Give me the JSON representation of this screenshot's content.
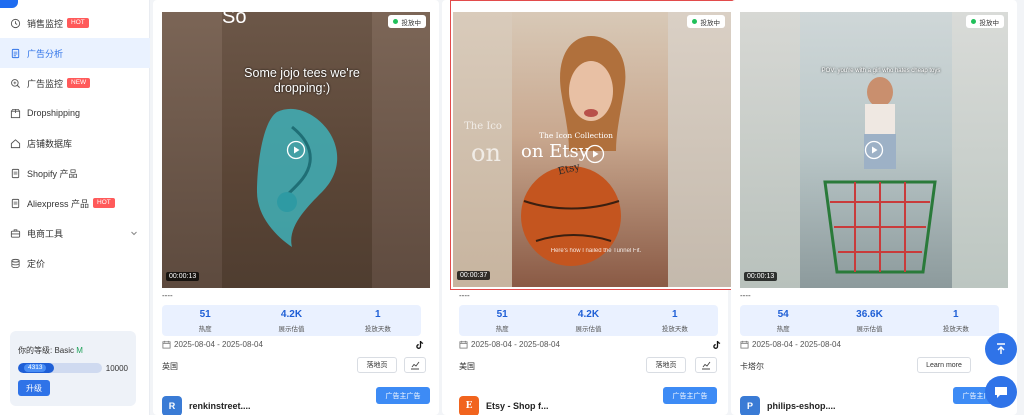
{
  "sidebar": {
    "items": [
      {
        "label": "销售监控",
        "badge": "HOT",
        "icon": "clock-icon"
      },
      {
        "label": "广告分析",
        "badge": "",
        "icon": "document-icon"
      },
      {
        "label": "广告监控",
        "badge": "NEW",
        "icon": "search-icon"
      },
      {
        "label": "Dropshipping",
        "badge": "",
        "icon": "box-icon"
      },
      {
        "label": "店铺数据库",
        "badge": "",
        "icon": "home-icon"
      },
      {
        "label": "Shopify 产品",
        "badge": "",
        "icon": "page-icon"
      },
      {
        "label": "Aliexpress 产品",
        "badge": "HOT",
        "icon": "page-icon"
      },
      {
        "label": "电商工具",
        "badge": "",
        "icon": "toolbox-icon"
      },
      {
        "label": "定价",
        "badge": "",
        "icon": "database-icon"
      }
    ],
    "level": {
      "label": "你的等级: Basic",
      "level_value": "M",
      "progress_current": "4313",
      "progress_max": "10000",
      "progress_fraction": 0.4313,
      "upgrade_label": "升级"
    }
  },
  "cards": [
    {
      "overlay_text": "Some jojo tees we're dropping:)",
      "top_text": "So",
      "status": "投放中",
      "duration": "00:00:13",
      "title": "----",
      "stats": [
        {
          "value": "51",
          "label": "热度"
        },
        {
          "value": "4.2K",
          "label": "展示估值"
        },
        {
          "value": "1",
          "label": "投放天数"
        }
      ],
      "date_range": "2025-08-04 - 2025-08-04",
      "country": "英国",
      "landing_label": "落地页",
      "advertiser_button": "广告主广告",
      "advertiser_initial": "R",
      "advertiser_name": "renkinstreet....",
      "avatar_color": "#3a7bd5"
    },
    {
      "overlay_text": "The Icon Collection",
      "overlay_text_big": "on Etsy",
      "side_text_small": "The Ico",
      "side_text_big": "on",
      "basketball_text": "Etsy",
      "caption_text": "Here's how I nailed the Tunnel Fit.",
      "status": "投放中",
      "duration": "00:00:37",
      "title": "----",
      "stats": [
        {
          "value": "51",
          "label": "热度"
        },
        {
          "value": "4.2K",
          "label": "展示估值"
        },
        {
          "value": "1",
          "label": "投放天数"
        }
      ],
      "date_range": "2025-08-04 - 2025-08-04",
      "country": "美国",
      "landing_label": "落地页",
      "advertiser_button": "广告主广告",
      "advertiser_initial": "E",
      "advertiser_name": "Etsy - Shop f...",
      "avatar_color": "#f1641e"
    },
    {
      "overlay_text": "POV: you're with a girl who hates cheap toys",
      "status": "投放中",
      "duration": "00:00:13",
      "title": "----",
      "stats": [
        {
          "value": "54",
          "label": "热度"
        },
        {
          "value": "36.6K",
          "label": "展示估值"
        },
        {
          "value": "1",
          "label": "投放天数"
        }
      ],
      "date_range": "2025-08-04 - 2025-08-04",
      "country": "卡塔尔",
      "landing_label": "Learn more",
      "advertiser_button": "广告主广告",
      "advertiser_initial": "P",
      "advertiser_name": "philips-eshop....",
      "avatar_color": "#3a7bd5"
    }
  ],
  "colors": {
    "accent": "#2f73e8",
    "hot": "#ff5a5a",
    "live": "#20c05a",
    "selected_outline": "#e24b4b"
  }
}
